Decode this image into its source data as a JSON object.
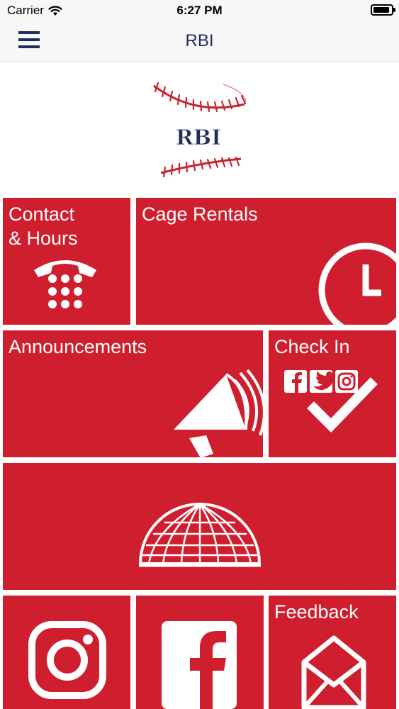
{
  "status_bar": {
    "carrier": "Carrier",
    "time": "6:27 PM",
    "battery_level": 0.85
  },
  "nav": {
    "title": "RBI",
    "menu_icon": "hamburger-menu-icon"
  },
  "logo": {
    "text": "RBI",
    "icon": "baseball-logo"
  },
  "tiles": {
    "contact": {
      "line1": "Contact",
      "line2": "& Hours",
      "icon": "telephone-icon"
    },
    "cage_rentals": {
      "label": "Cage Rentals",
      "icon": "clock-icon"
    },
    "announcements": {
      "label": "Announcements",
      "icon": "megaphone-icon"
    },
    "check_in": {
      "label": "Check In",
      "icon": "social-check-icon"
    },
    "dome": {
      "icon": "dome-icon"
    },
    "instagram": {
      "icon": "instagram-icon"
    },
    "facebook": {
      "icon": "facebook-icon"
    },
    "feedback": {
      "label": "Feedback",
      "icon": "envelope-icon"
    }
  },
  "colors": {
    "tile_red": "#cf1f2f",
    "navy": "#1f2e5a",
    "logo_red": "#c8252f"
  }
}
